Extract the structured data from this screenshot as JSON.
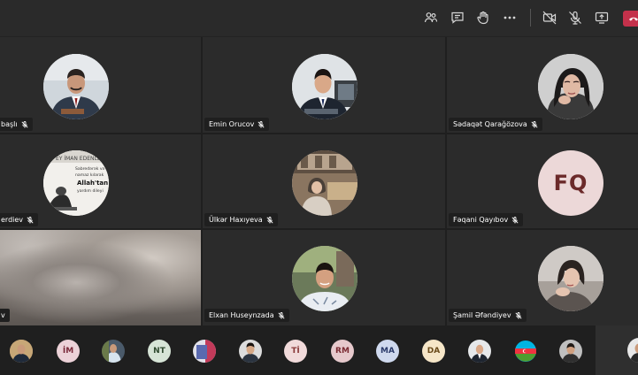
{
  "toolbar": {
    "icons": [
      "participants-icon",
      "chat-icon",
      "raise-hand-icon",
      "more-icon",
      "camera-off-icon",
      "mic-off-icon",
      "share-screen-icon",
      "hang-up-icon"
    ],
    "leave_color": "#c4314b"
  },
  "participants": [
    {
      "name": "başlı",
      "type": "photo"
    },
    {
      "name": "Emin Orucov",
      "type": "photo"
    },
    {
      "name": "Sədaqət Qarağözova",
      "type": "photo"
    },
    {
      "name": "erdiev",
      "type": "photo"
    },
    {
      "name": "Ülkər Haxıyeva",
      "type": "photo"
    },
    {
      "name": "Fəqani Qayıbov",
      "type": "initials",
      "initials": "FQ"
    },
    {
      "name": "v",
      "type": "video"
    },
    {
      "name": "Elxan Huseynzada",
      "type": "photo"
    },
    {
      "name": "Şamil Əfəndiyev",
      "type": "photo"
    }
  ],
  "poster_text": {
    "line1": "EY İMAN EDENLER!",
    "line2": "Sabredərək və",
    "line3": "namaz kılarak",
    "line4": "Allah'tan",
    "line5": "yardım dileyi"
  },
  "strip": [
    {
      "type": "photo"
    },
    {
      "type": "initials",
      "text": "İM",
      "bg": "#ecd2d8"
    },
    {
      "type": "photo"
    },
    {
      "type": "initials",
      "text": "NT",
      "bg": "#d6e4d6"
    },
    {
      "type": "photo"
    },
    {
      "type": "photo"
    },
    {
      "type": "initials",
      "text": "Tİ",
      "bg": "#f1dada"
    },
    {
      "type": "initials",
      "text": "RM",
      "bg": "#e6c9cc"
    },
    {
      "type": "initials",
      "text": "MA",
      "bg": "#cfd9ee"
    },
    {
      "type": "initials",
      "text": "DA",
      "bg": "#f6e6c8"
    },
    {
      "type": "photo"
    },
    {
      "type": "flag"
    },
    {
      "type": "photo"
    },
    {
      "type": "photo"
    }
  ]
}
